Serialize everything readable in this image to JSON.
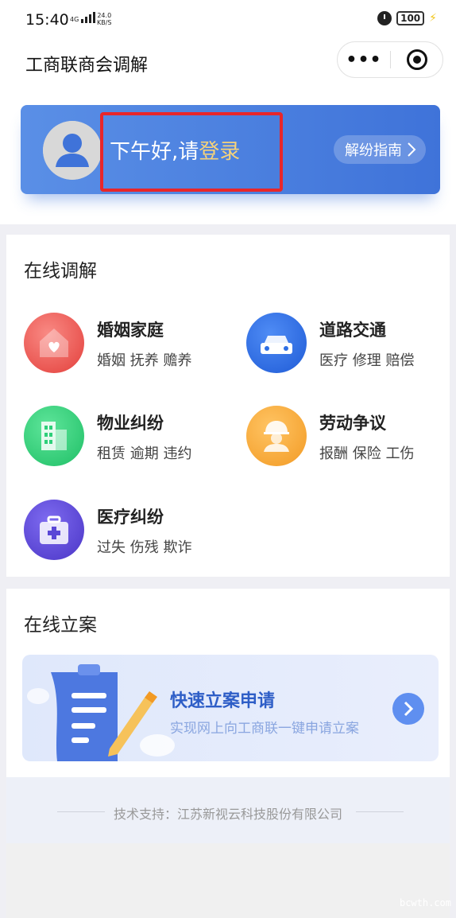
{
  "status_bar": {
    "time": "15:40",
    "network": "4G",
    "speed_value": "24.0",
    "speed_unit": "KB/S",
    "battery": "100"
  },
  "nav": {
    "title": "工商联商会调解",
    "more_icon": "more-dots-icon",
    "close_icon": "target-circle-icon"
  },
  "user_card": {
    "greeting_prefix": "下午好,请",
    "login_text": "登录",
    "guide_label": "解纷指南",
    "colors": {
      "card_start": "#5a8fe6",
      "card_end": "#3f73d9",
      "login": "#f6d37a",
      "highlight": "#e8262a"
    }
  },
  "online_mediation": {
    "title": "在线调解",
    "items": [
      {
        "title": "婚姻家庭",
        "subtitle": "婚姻 抚养 赡养",
        "icon": "house-heart-icon",
        "color": "#ef5350"
      },
      {
        "title": "道路交通",
        "subtitle": "医疗 修理 赔偿",
        "icon": "car-icon",
        "color": "#2f6fe4"
      },
      {
        "title": "物业纠纷",
        "subtitle": "租赁 逾期 违约",
        "icon": "building-icon",
        "color": "#2ecf79"
      },
      {
        "title": "劳动争议",
        "subtitle": "报酬 保险 工伤",
        "icon": "worker-icon",
        "color": "#f7a93a"
      },
      {
        "title": "医疗纠纷",
        "subtitle": "过失 伤残 欺诈",
        "icon": "medical-kit-icon",
        "color": "#5a48d6"
      }
    ]
  },
  "online_filing": {
    "title": "在线立案",
    "banner_title": "快速立案申请",
    "banner_subtitle": "实现网上向工商联一键申请立案",
    "icon": "clipboard-pencil-icon"
  },
  "footer": {
    "text": "技术支持：江苏新视云科技股份有限公司"
  },
  "watermark": "bcwth.com"
}
